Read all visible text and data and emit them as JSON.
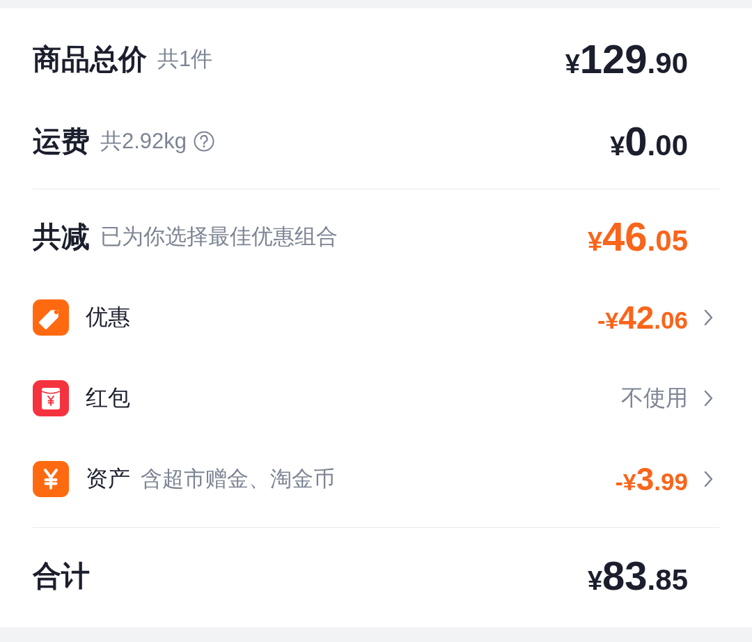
{
  "summary": [
    {
      "label": "商品总价",
      "note": "共1件",
      "highlighted": false,
      "amount": {
        "prefix": "¥",
        "integer": "129",
        "decimal": ".90"
      }
    },
    {
      "label": "运费",
      "note": "共2.92kg",
      "help": true,
      "highlighted": false,
      "amount": {
        "prefix": "¥",
        "integer": "0",
        "decimal": ".00"
      }
    }
  ],
  "discount": {
    "label": "共减",
    "note": "已为你选择最佳优惠组合",
    "highlighted": true,
    "amount": {
      "prefix": "¥",
      "integer": "46",
      "decimal": ".05"
    },
    "items": [
      {
        "kind": "coupon",
        "label": "优惠",
        "highlighted": true,
        "amount": {
          "prefix": "-¥",
          "integer": "42",
          "decimal": ".06"
        }
      },
      {
        "kind": "red_packet",
        "label": "红包",
        "value": "不使用"
      },
      {
        "kind": "assets",
        "label": "资产",
        "note": "含超市赠金、淘金币",
        "highlighted": true,
        "amount": {
          "prefix": "-¥",
          "integer": "3",
          "decimal": ".99"
        }
      }
    ]
  },
  "total": {
    "label": "合计",
    "highlighted": false,
    "amount": {
      "prefix": "¥",
      "integer": "83",
      "decimal": ".85"
    }
  }
}
